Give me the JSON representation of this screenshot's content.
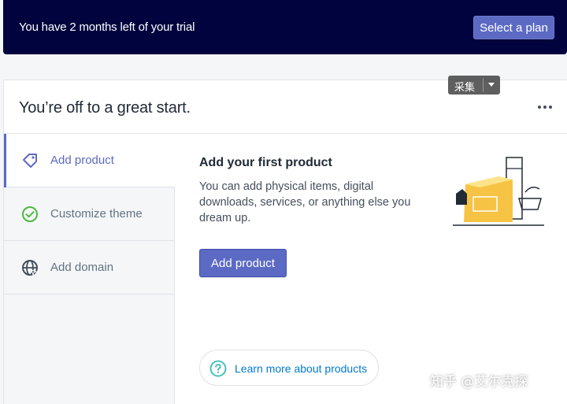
{
  "banner": {
    "trial_text": "You have 2 months left of your trial",
    "select_plan_label": "Select a plan",
    "background_color": "#00033d"
  },
  "card": {
    "title": "You’re off to a great start.",
    "more_icon": "more-horizontal-icon"
  },
  "steps": [
    {
      "label": "Add product",
      "icon": "tag-icon",
      "active": true
    },
    {
      "label": "Customize theme",
      "icon": "check-circle-icon",
      "active": false
    },
    {
      "label": "Add domain",
      "icon": "globe-icon",
      "active": false
    }
  ],
  "content": {
    "heading": "Add your first product",
    "description": "You can add physical items, digital downloads, services, or anything else you dream up.",
    "button_label": "Add product",
    "learn_more_label": "Learn more about products",
    "learn_more_icon": "question-circle-icon"
  },
  "overlay": {
    "badge_text": "采集"
  },
  "watermark": {
    "text": "知乎 @艾尔克探"
  },
  "colors": {
    "accent": "#5c6ac4",
    "link": "#007ace",
    "success": "#50b83c"
  }
}
